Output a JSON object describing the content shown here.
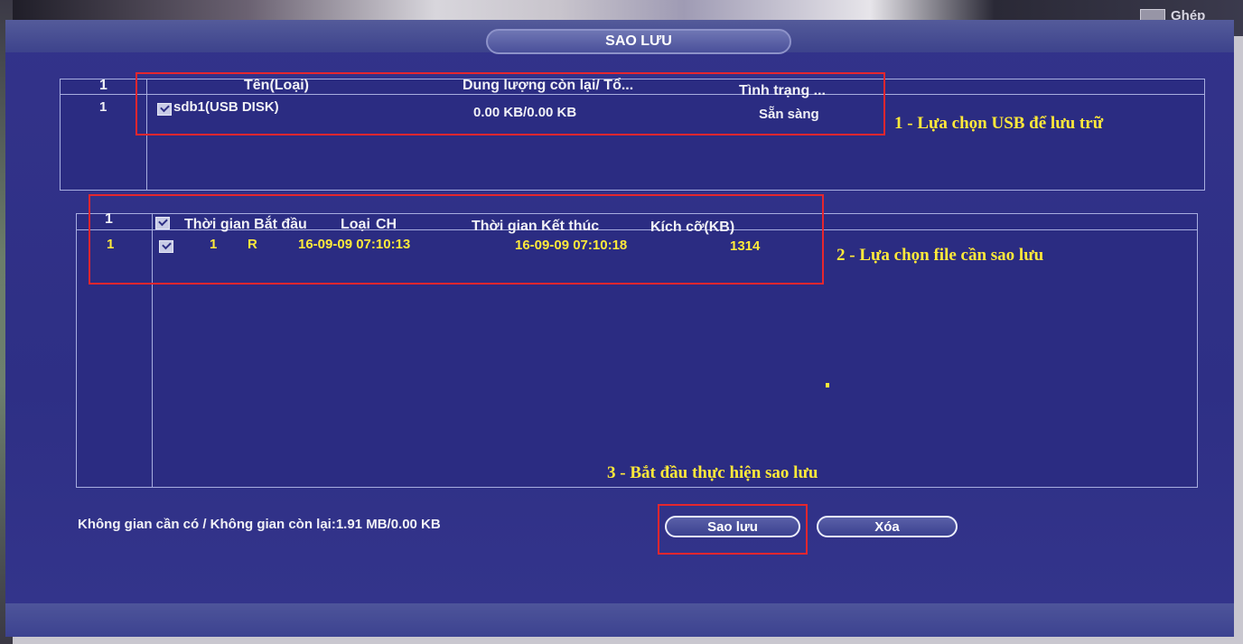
{
  "window": {
    "title": "SAO LƯU",
    "background_label": "Ghép"
  },
  "device_table": {
    "headers": [
      "1",
      "Tên(Loại)",
      "Dung lượng còn lại/ Tổ...",
      "Tình trạng ..."
    ],
    "rows": [
      {
        "index": "1",
        "name": "sdb1(USB DISK)",
        "capacity": "0.00 KB/0.00 KB",
        "status": "Sẵn sàng",
        "checked": true
      }
    ]
  },
  "file_table": {
    "headers": [
      "1",
      "Thời gian Bắt đầu",
      "Loại",
      "CH",
      "Thời gian Kết thúc",
      "Kích cỡ(KB)"
    ],
    "rows": [
      {
        "index": "1",
        "channel": "1",
        "type": "R",
        "start": "16-09-09 07:10:13",
        "end": "16-09-09 07:10:18",
        "size": "1314",
        "checked": true
      }
    ]
  },
  "footer": {
    "space_text": "Không gian cần có / Không gian còn lại:1.91 MB/0.00 KB",
    "backup_button": "Sao lưu",
    "delete_button": "Xóa"
  },
  "annotations": {
    "step1": "1 - Lựa chọn USB để lưu trữ",
    "step2": "2 - Lựa chọn file cần sao lưu",
    "step3": "3 - Bắt đầu thực hiện sao lưu"
  },
  "colors": {
    "screen_bg": "#2e2f85",
    "annotation_text": "#ffe93a",
    "highlight_box": "#e6262e",
    "selected_row_text": "#ffea3a"
  }
}
